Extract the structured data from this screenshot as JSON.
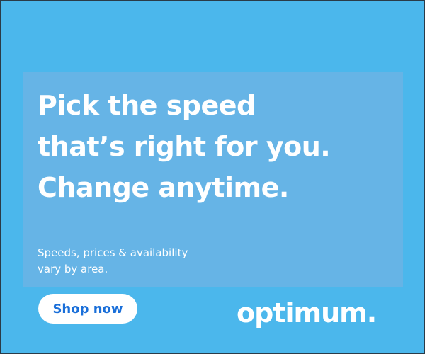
{
  "ad": {
    "headline": [
      "Pick the speed",
      "that’s right for you.",
      "Change anytime."
    ],
    "disclaimer": [
      "Speeds, prices & availability",
      "vary by area."
    ],
    "cta_label": "Shop now",
    "brand": "optimum.",
    "colors": {
      "background": "#4bb7ec",
      "panel": "#66b4e6",
      "cta_text": "#1a6fd9"
    }
  }
}
